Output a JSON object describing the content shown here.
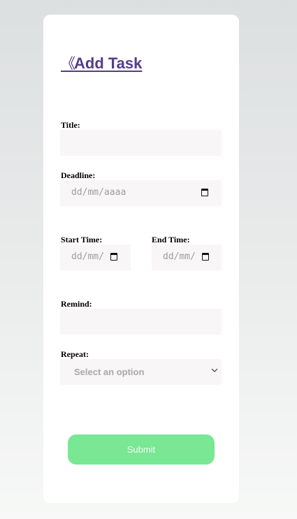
{
  "header": {
    "back_glyph": "《",
    "title": "Add Task"
  },
  "form": {
    "title_label": "Title:",
    "title_value": "",
    "deadline_label": "Deadline:",
    "deadline_placeholder": "dd/mm/aaaa",
    "start_time_label": "Start Time:",
    "start_time_placeholder": "dd/mm/",
    "end_time_label": "End Time:",
    "end_time_placeholder": "dd/mm/",
    "remind_label": "Remind:",
    "remind_value": "",
    "repeat_label": "Repeat:",
    "repeat_selected": "Select an option"
  },
  "actions": {
    "submit_label": "Submit"
  },
  "colors": {
    "accent_link": "#553c8b",
    "submit_bg": "#79e794",
    "field_bg": "#f8f6f7"
  },
  "icons": {
    "back": "double-chevron-left-icon",
    "calendar": "calendar-icon",
    "dropdown": "chevron-down-icon"
  }
}
